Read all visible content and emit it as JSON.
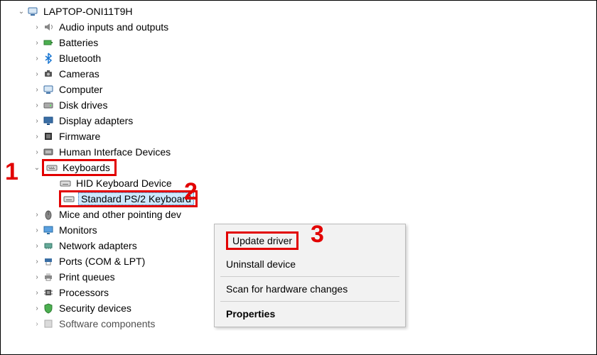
{
  "root": {
    "label": "LAPTOP-ONI11T9H"
  },
  "categories": [
    {
      "label": "Audio inputs and outputs",
      "icon": "speaker"
    },
    {
      "label": "Batteries",
      "icon": "battery"
    },
    {
      "label": "Bluetooth",
      "icon": "bluetooth"
    },
    {
      "label": "Cameras",
      "icon": "camera"
    },
    {
      "label": "Computer",
      "icon": "computer"
    },
    {
      "label": "Disk drives",
      "icon": "disk"
    },
    {
      "label": "Display adapters",
      "icon": "display"
    },
    {
      "label": "Firmware",
      "icon": "firmware"
    },
    {
      "label": "Human Interface Devices",
      "icon": "hid"
    },
    {
      "label": "Keyboards",
      "icon": "keyboard",
      "expanded": true
    },
    {
      "label": "Mice and other pointing dev",
      "icon": "mouse",
      "truncated": true
    },
    {
      "label": "Monitors",
      "icon": "monitor"
    },
    {
      "label": "Network adapters",
      "icon": "network"
    },
    {
      "label": "Ports (COM & LPT)",
      "icon": "port"
    },
    {
      "label": "Print queues",
      "icon": "printer"
    },
    {
      "label": "Processors",
      "icon": "cpu"
    },
    {
      "label": "Security devices",
      "icon": "security"
    },
    {
      "label": "Software components",
      "icon": "software"
    }
  ],
  "keyboards_children": [
    {
      "label": "HID Keyboard Device"
    },
    {
      "label": "Standard PS/2 Keyboard",
      "selected": true
    }
  ],
  "context_menu": {
    "items": [
      {
        "label": "Update driver",
        "highlight": true
      },
      {
        "label": "Uninstall device"
      },
      {
        "sep": true
      },
      {
        "label": "Scan for hardware changes"
      },
      {
        "sep": true
      },
      {
        "label": "Properties",
        "bold": true
      }
    ]
  },
  "annotations": {
    "n1": "1",
    "n2": "2",
    "n3": "3"
  }
}
